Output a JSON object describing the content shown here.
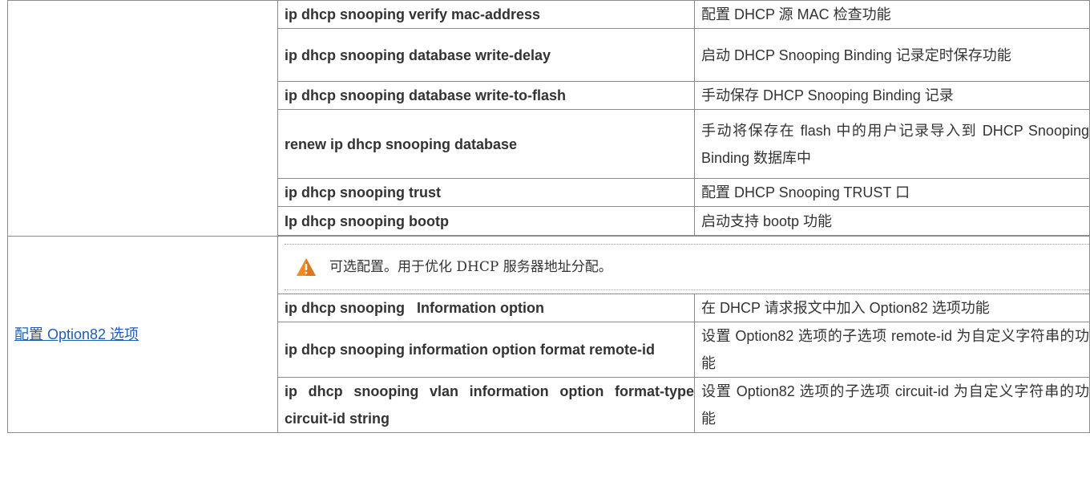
{
  "table": {
    "rows_top": [
      {
        "command": "ip dhcp snooping verify mac-address",
        "description": "配置 DHCP 源 MAC 检查功能"
      },
      {
        "command": "ip dhcp snooping database write-delay",
        "description": "启动 DHCP Snooping Binding 记录定时保存功能"
      },
      {
        "command": "ip dhcp snooping database write-to-flash",
        "description": "手动保存 DHCP Snooping Binding 记录"
      },
      {
        "command": "renew ip dhcp snooping database",
        "description": "手动将保存在 flash 中的用户记录导入到 DHCP Snooping Binding 数据库中"
      },
      {
        "command": "ip dhcp snooping trust",
        "description": "配置 DHCP Snooping TRUST 口"
      },
      {
        "command": "Ip dhcp snooping bootp",
        "description": "启动支持 bootp 功能"
      }
    ],
    "option82": {
      "link_label": "配置 Option82 选项",
      "note_icon": "warning-triangle-icon",
      "note_text": "可选配置。用于优化 DHCP 服务器地址分配。",
      "rows": [
        {
          "command": "ip dhcp snooping   Information option",
          "description": "在 DHCP 请求报文中加入 Option82 选项功能"
        },
        {
          "command": "ip dhcp snooping information option format remote-id",
          "description": "设置 Option82 选项的子选项 remote-id 为自定义字符串的功能"
        },
        {
          "command": "ip dhcp snooping vlan information option format-type circuit-id string",
          "description": "设置 Option82 选项的子选项 circuit-id 为自定义字符串的功能"
        }
      ]
    }
  },
  "colors": {
    "border": "#8c8c8c",
    "link": "#1f5db5",
    "warning": "#f08a24"
  }
}
